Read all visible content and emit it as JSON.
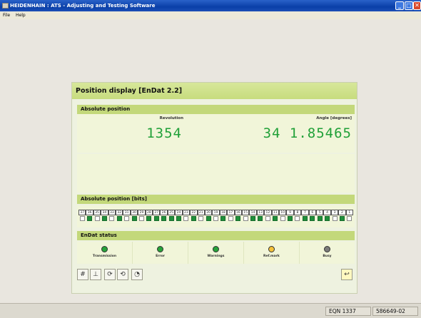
{
  "window": {
    "title": "HEIDENHAIN : ATS - Adjusting and Testing Software",
    "minimize_label": "_",
    "maximize_label": "□",
    "close_label": "✕"
  },
  "menu": [
    "File",
    "Help"
  ],
  "panel": {
    "title": "Position display [EnDat 2.2]",
    "absolute_position": {
      "heading": "Absolute position",
      "revolution_label": "Revolution",
      "revolution_value": "1354",
      "angle_label": "Angle [degrees]",
      "angle_value": "34 1.85465"
    },
    "bits": {
      "heading": "Absolute position [bits]",
      "labels": [
        "37",
        "36",
        "35",
        "34",
        "33",
        "32",
        "31",
        "30",
        "29",
        "28",
        "27",
        "26",
        "25",
        "24",
        "23",
        "22",
        "21",
        "20",
        "19",
        "18",
        "17",
        "16",
        "15",
        "14",
        "13",
        "12",
        "11",
        "10",
        "9",
        "8",
        "7",
        "6",
        "5",
        "4",
        "3",
        "2",
        "1"
      ],
      "states": [
        0,
        1,
        0,
        1,
        0,
        1,
        0,
        1,
        0,
        1,
        1,
        1,
        1,
        1,
        0,
        1,
        0,
        1,
        0,
        1,
        0,
        1,
        0,
        1,
        1,
        0,
        1,
        0,
        1,
        0,
        1,
        1,
        1,
        1,
        0,
        1,
        0
      ]
    },
    "status": {
      "heading": "EnDat status",
      "items": [
        {
          "label": "Transmission",
          "color": "#27a33a"
        },
        {
          "label": "Error",
          "color": "#27a33a"
        },
        {
          "label": "Warnings",
          "color": "#27a33a"
        },
        {
          "label": "Ref.mark",
          "color": "#f4c13a"
        },
        {
          "label": "Busy",
          "color": "#7a7a7a"
        }
      ]
    },
    "toolbar": {
      "icons": [
        "grid-icon",
        "axes-icon",
        "rotate-icon",
        "rotate-alt-icon",
        "gauge-icon"
      ],
      "exit_icon": "exit-icon"
    }
  },
  "statusbar": {
    "device": "EQN 1337",
    "id": "586649-02"
  }
}
